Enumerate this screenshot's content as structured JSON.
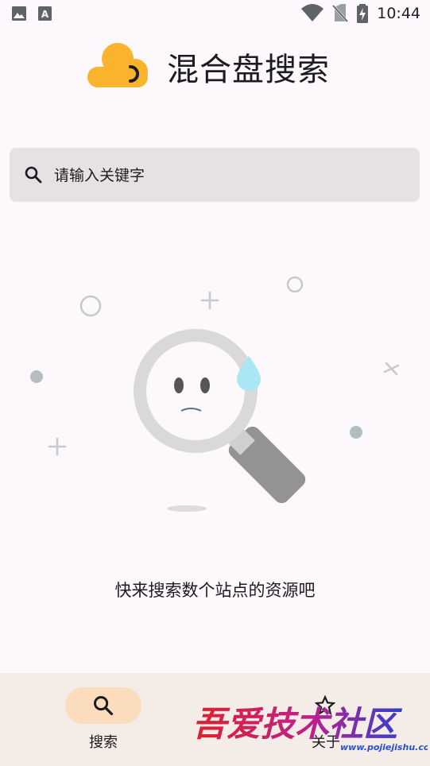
{
  "status_bar": {
    "time": "10:44",
    "icons": [
      "image-icon",
      "font-icon",
      "wifi-icon",
      "no-sim-icon",
      "battery-charging-icon"
    ]
  },
  "header": {
    "title": "混合盘搜索",
    "logo_icon": "cloud-logo-icon"
  },
  "search": {
    "placeholder": "请输入关键字",
    "value": ""
  },
  "empty_state": {
    "illustration": "sad-magnifier-illustration",
    "message": "快来搜索数个站点的资源吧"
  },
  "bottom_nav": {
    "items": [
      {
        "label": "搜索",
        "icon": "search-icon",
        "selected": true
      },
      {
        "label": "关于",
        "icon": "star-icon",
        "selected": false
      }
    ]
  },
  "watermark": {
    "title": "吾爱技术社区",
    "url": "www.pojiejishu.com"
  },
  "colors": {
    "background": "#fdf8fc",
    "search_bar": "#e7e1e5",
    "accent_logo": "#f9b32d",
    "nav_pill": "#fbdcbc",
    "nav_background": "#f4ece7"
  }
}
